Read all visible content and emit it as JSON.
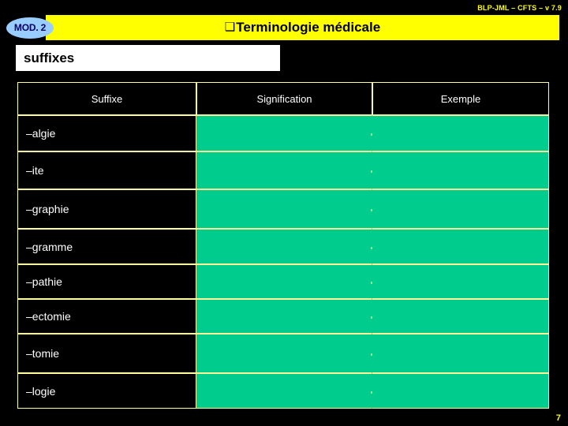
{
  "header": {
    "version_stamp": "BLP-JML – CFTS – v 7.9",
    "module_badge": "MOD. 2",
    "title_bullet": "❑",
    "title": "Terminologie médicale"
  },
  "subtitle": {
    "text": "suffixes"
  },
  "table": {
    "columns": [
      "Suffixe",
      "Signification",
      "Exemple"
    ],
    "rows": [
      {
        "suffix": "–algie",
        "signification": "",
        "exemple": ""
      },
      {
        "suffix": "–ite",
        "signification": "",
        "exemple": ""
      },
      {
        "suffix": "–graphie",
        "signification": "",
        "exemple": ""
      },
      {
        "suffix": "–gramme",
        "signification": "",
        "exemple": ""
      },
      {
        "suffix": "–pathie",
        "signification": "",
        "exemple": ""
      },
      {
        "suffix": "–ectomie",
        "signification": "",
        "exemple": ""
      },
      {
        "suffix": "–tomie",
        "signification": "",
        "exemple": ""
      },
      {
        "suffix": "–logie",
        "signification": "",
        "exemple": ""
      }
    ]
  },
  "footer": {
    "page_number": "7"
  },
  "colors": {
    "background": "#000000",
    "accent_yellow": "#FFFF00",
    "border_yellow": "#FFFF99",
    "answer_green": "#00CC8E",
    "badge_blue": "#99CCFF",
    "badge_text": "#000066",
    "white": "#FFFFFF"
  }
}
